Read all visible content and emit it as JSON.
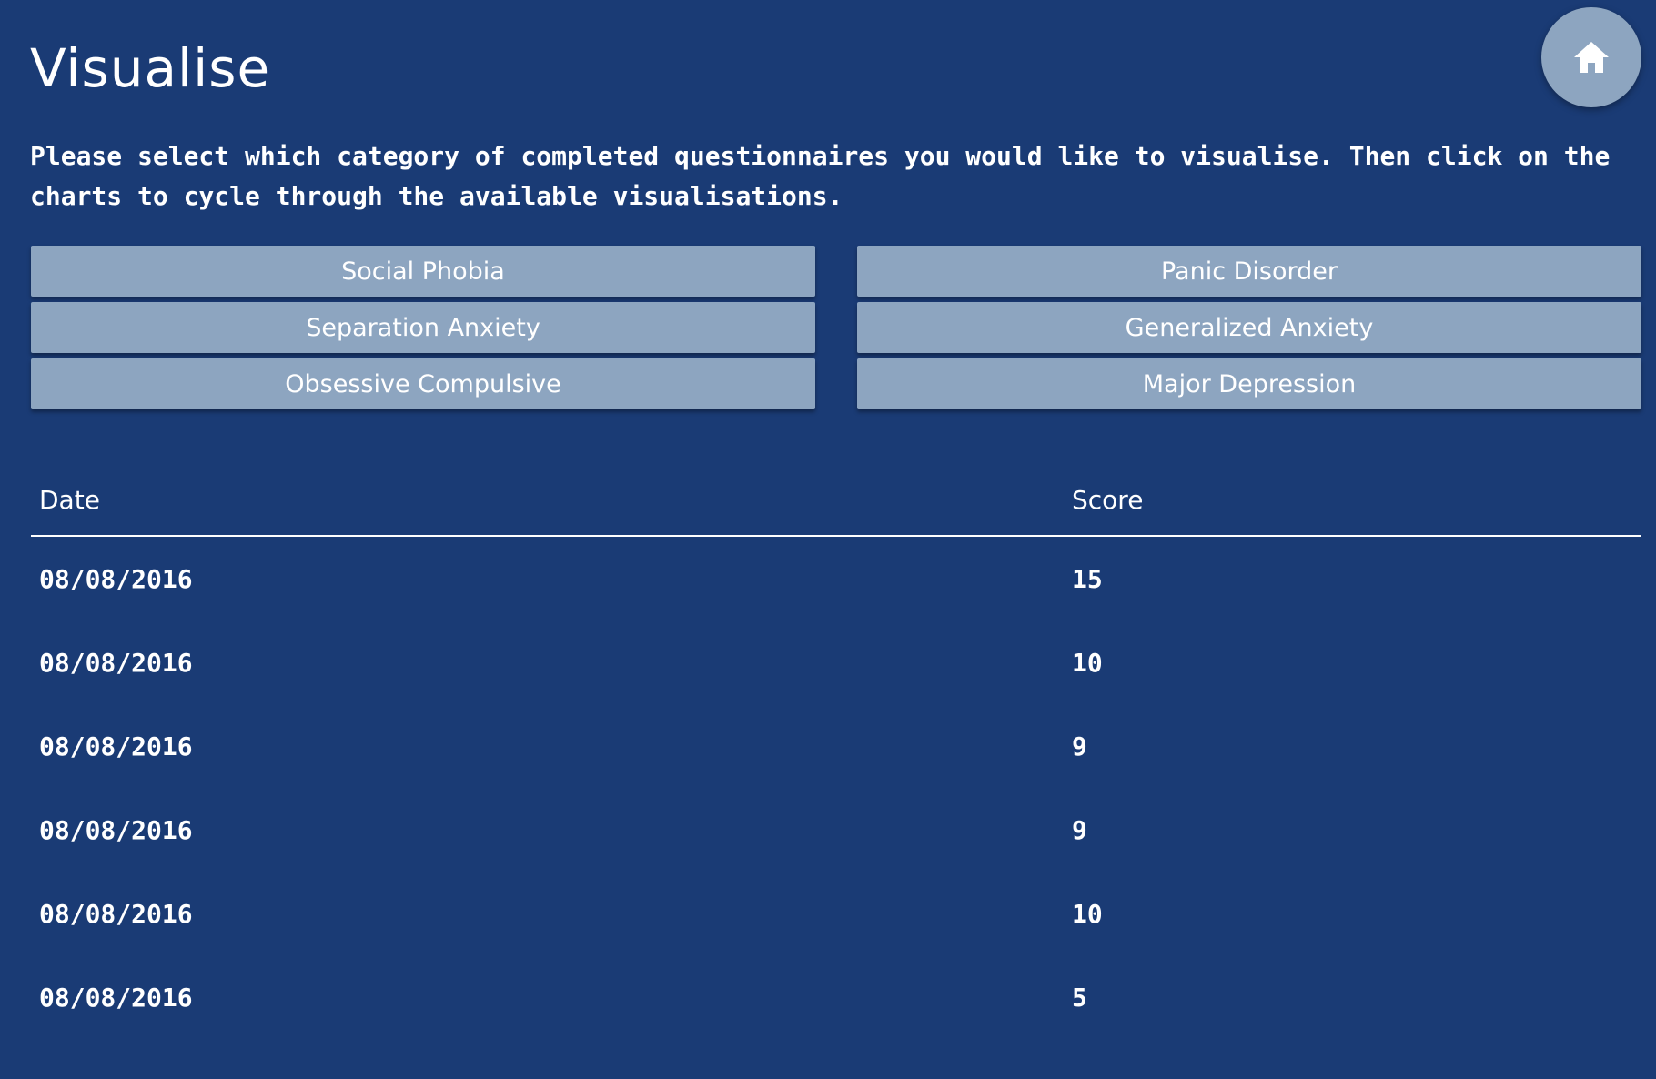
{
  "page": {
    "title": "Visualise",
    "intro": "Please select which category of completed questionnaires you would like to visualise. Then click on the charts to cycle through the available visualisations."
  },
  "home_button": {
    "icon": "home-icon"
  },
  "categories": [
    {
      "label": "Social Phobia"
    },
    {
      "label": "Panic Disorder"
    },
    {
      "label": "Separation Anxiety"
    },
    {
      "label": "Generalized Anxiety"
    },
    {
      "label": "Obsessive Compulsive"
    },
    {
      "label": "Major Depression"
    }
  ],
  "table": {
    "headers": {
      "date": "Date",
      "score": "Score"
    },
    "rows": [
      {
        "date": "08/08/2016",
        "score": "15"
      },
      {
        "date": "08/08/2016",
        "score": "10"
      },
      {
        "date": "08/08/2016",
        "score": "9"
      },
      {
        "date": "08/08/2016",
        "score": "9"
      },
      {
        "date": "08/08/2016",
        "score": "10"
      },
      {
        "date": "08/08/2016",
        "score": "5"
      }
    ]
  },
  "colors": {
    "background": "#1a3b75",
    "button": "#8da5c0",
    "text": "#ffffff"
  }
}
